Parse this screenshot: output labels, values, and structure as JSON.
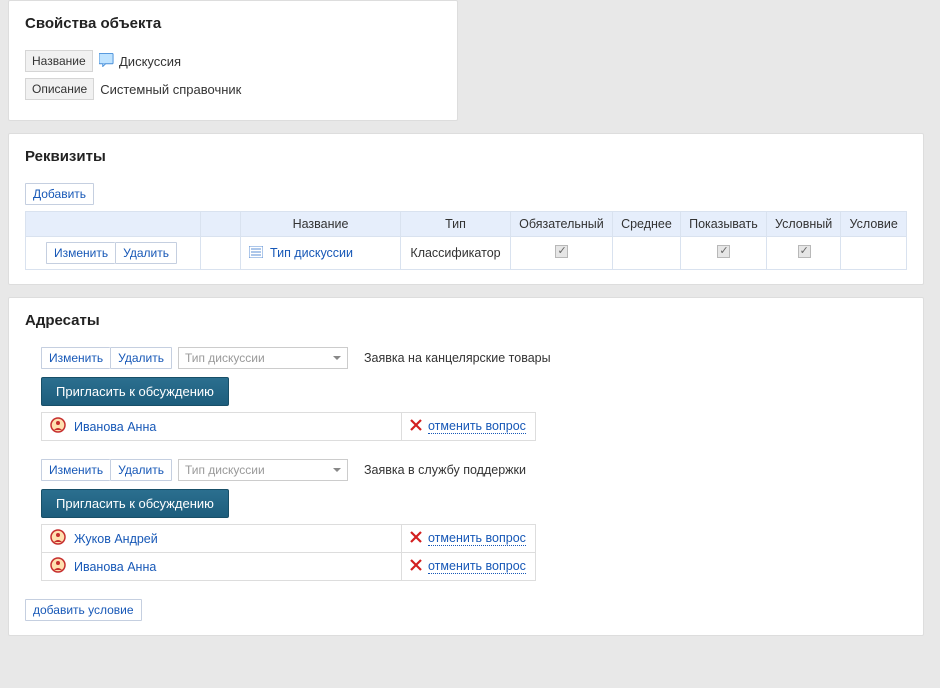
{
  "panel_props": {
    "title": "Свойства объекта",
    "rows": [
      {
        "label": "Название",
        "value": "Дискуссия",
        "has_icon": true
      },
      {
        "label": "Описание",
        "value": "Системный справочник",
        "has_icon": false
      }
    ]
  },
  "panel_req": {
    "title": "Реквизиты",
    "add_button": "Добавить",
    "edit_button": "Изменить",
    "delete_button": "Удалить",
    "columns": [
      "",
      "",
      "Название",
      "Тип",
      "Обязательный",
      "Среднее",
      "Показывать",
      "Условный",
      "Условие"
    ],
    "row": {
      "name_label": "Тип дискуссии",
      "type_label": "Классификатор",
      "required": true,
      "average": false,
      "show": true,
      "conditional": true,
      "condition": ""
    }
  },
  "panel_addr": {
    "title": "Адресаты",
    "edit_button": "Изменить",
    "delete_button": "Удалить",
    "select_placeholder": "Тип дискуссии",
    "invite_button": "Пригласить к обсуждению",
    "cancel_label": "отменить вопрос",
    "add_condition": "добавить условие",
    "blocks": [
      {
        "caption": "Заявка на канцелярские товары",
        "participants": [
          "Иванова Анна"
        ]
      },
      {
        "caption": "Заявка в службу поддержки",
        "participants": [
          "Жуков Андрей",
          "Иванова Анна"
        ]
      }
    ]
  }
}
